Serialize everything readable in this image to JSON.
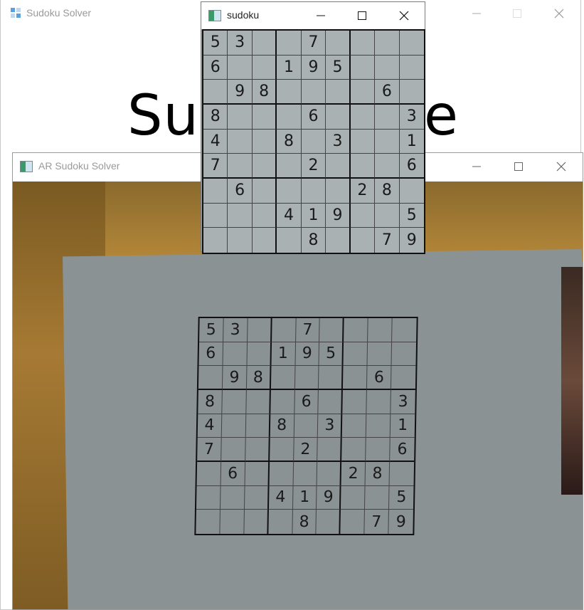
{
  "windows": {
    "main": {
      "title": "Sudoku Solver",
      "heading_left": "Sud",
      "heading_right": "e"
    },
    "ar": {
      "title": "AR Sudoku Solver"
    },
    "sudoku": {
      "title": "sudoku"
    }
  },
  "controls": {
    "minimize_icon": "minimize-icon",
    "maximize_icon": "maximize-icon",
    "close_icon": "close-icon"
  },
  "puzzle": [
    [
      "5",
      "3",
      "",
      "",
      "7",
      "",
      "",
      "",
      ""
    ],
    [
      "6",
      "",
      "",
      "1",
      "9",
      "5",
      "",
      "",
      ""
    ],
    [
      "",
      "9",
      "8",
      "",
      "",
      "",
      "",
      "6",
      ""
    ],
    [
      "8",
      "",
      "",
      "",
      "6",
      "",
      "",
      "",
      "3"
    ],
    [
      "4",
      "",
      "",
      "8",
      "",
      "3",
      "",
      "",
      "1"
    ],
    [
      "7",
      "",
      "",
      "",
      "2",
      "",
      "",
      "",
      "6"
    ],
    [
      "",
      "6",
      "",
      "",
      "",
      "",
      "2",
      "8",
      ""
    ],
    [
      "",
      "",
      "",
      "4",
      "1",
      "9",
      "",
      "",
      "5"
    ],
    [
      "",
      "",
      "",
      "",
      "8",
      "",
      "",
      "7",
      "9"
    ]
  ],
  "colors": {
    "paper": "#8b9294",
    "wall": "#c79342",
    "grid_line": "#111111"
  }
}
